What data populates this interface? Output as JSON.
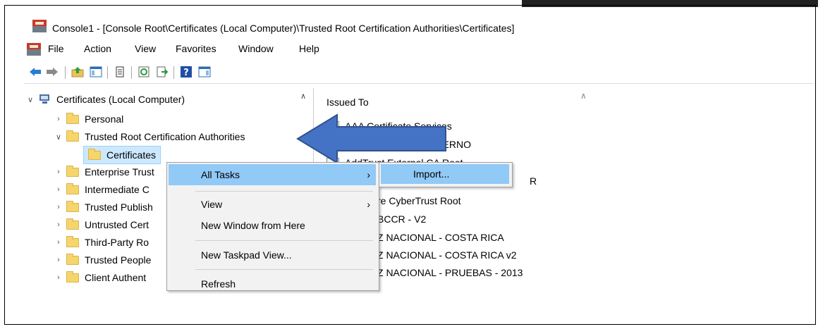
{
  "window": {
    "title": "Console1 - [Console Root\\Certificates (Local Computer)\\Trusted Root Certification Authorities\\Certificates]"
  },
  "menu": [
    "File",
    "Action",
    "View",
    "Favorites",
    "Window",
    "Help"
  ],
  "toolbar": {
    "icons": [
      "back-arrow-icon",
      "forward-arrow-icon",
      "up-folder-icon",
      "show-hide-tree-icon",
      "properties-icon",
      "refresh-icon",
      "export-list-icon",
      "help-icon",
      "action-pane-icon"
    ]
  },
  "tree": {
    "root": "Certificates (Local Computer)",
    "items": [
      {
        "label": "Personal",
        "expanded": false
      },
      {
        "label": "Trusted Root Certification Authorities",
        "expanded": true
      },
      {
        "label": "Certificates",
        "selected": true
      },
      {
        "label": "Enterprise Trust",
        "expanded": false
      },
      {
        "label": "Intermediate C",
        "expanded": false
      },
      {
        "label": "Trusted Publish",
        "expanded": false
      },
      {
        "label": "Untrusted Cert",
        "expanded": false
      },
      {
        "label": "Third-Party Ro",
        "expanded": false
      },
      {
        "label": "Trusted People",
        "expanded": false
      },
      {
        "label": "Client Authent",
        "expanded": false
      }
    ]
  },
  "list": {
    "header": "Issued To",
    "rows": [
      "AAA Certificate Services",
      "INTERNO",
      "AddTrust External CA Root",
      "R",
      "re CyberTrust Root",
      "BCCR - V2",
      "Z NACIONAL - COSTA RICA",
      "Z NACIONAL - COSTA RICA v2",
      "Z NACIONAL - PRUEBAS - 2013"
    ]
  },
  "context_menu": {
    "items": [
      {
        "label": "All Tasks",
        "submenu": true,
        "highlighted": true
      },
      {
        "label": "View",
        "submenu": true
      },
      {
        "label": "New Window from Here"
      },
      {
        "label": "New Taskpad View..."
      },
      {
        "label": "Refresh"
      }
    ],
    "submenu_item": "Import..."
  },
  "colors": {
    "highlight": "#91c9f7",
    "selected_tree": "#cce8ff",
    "arrow": "#4472c4"
  }
}
